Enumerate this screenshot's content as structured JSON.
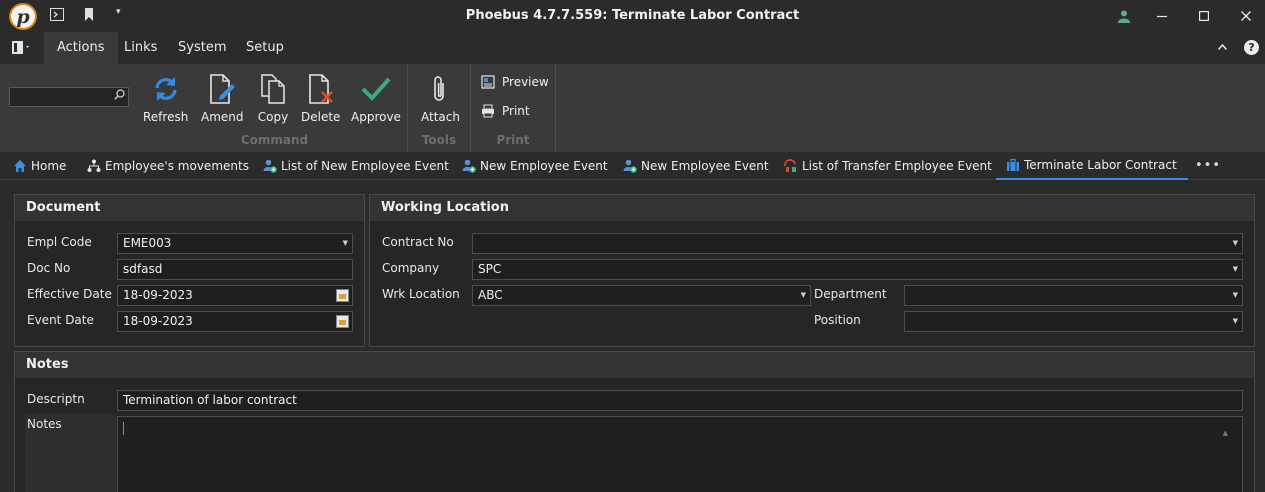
{
  "window": {
    "title": "Phoebus 4.7.7.559: Terminate Labor Contract",
    "logo_letter": "p"
  },
  "menu": {
    "tabs": [
      "Actions",
      "Links",
      "System",
      "Setup"
    ]
  },
  "ribbon": {
    "search_value": "",
    "buttons": [
      "Refresh",
      "Amend",
      "Copy",
      "Delete",
      "Approve",
      "Attach"
    ],
    "small_buttons": [
      "Preview",
      "Print"
    ],
    "groups": [
      "Command",
      "Tools",
      "Print"
    ]
  },
  "doc_tabs": [
    "Home",
    "Employee's movements",
    "List of New Employee Event",
    "New Employee Event",
    "New Employee Event",
    "List of Transfer Employee Event",
    "Terminate Labor Contract"
  ],
  "document": {
    "title": "Document",
    "labels": [
      "Empl Code",
      "Doc No",
      "Effective Date",
      "Event Date"
    ],
    "values": {
      "empl_code": "EME003",
      "doc_no": "sdfasd",
      "effective_date": "18-09-2023",
      "event_date": "18-09-2023"
    }
  },
  "working_location": {
    "title": "Working Location",
    "labels": [
      "Contract No",
      "Company",
      "Wrk Location",
      "Department",
      "Position"
    ],
    "values": {
      "contract_no": "",
      "company": "SPC",
      "wrk_location": "ABC",
      "department": "",
      "position": ""
    }
  },
  "notes": {
    "title": "Notes",
    "labels": [
      "Descriptn",
      "Notes"
    ],
    "values": {
      "descriptn": "Termination of labor contract",
      "notes": ""
    }
  },
  "colors": {
    "accent": "#3a8ee6",
    "approve": "#3aae7a",
    "delete_x": "#e24b2a",
    "logo_ring": "#d9831f"
  }
}
